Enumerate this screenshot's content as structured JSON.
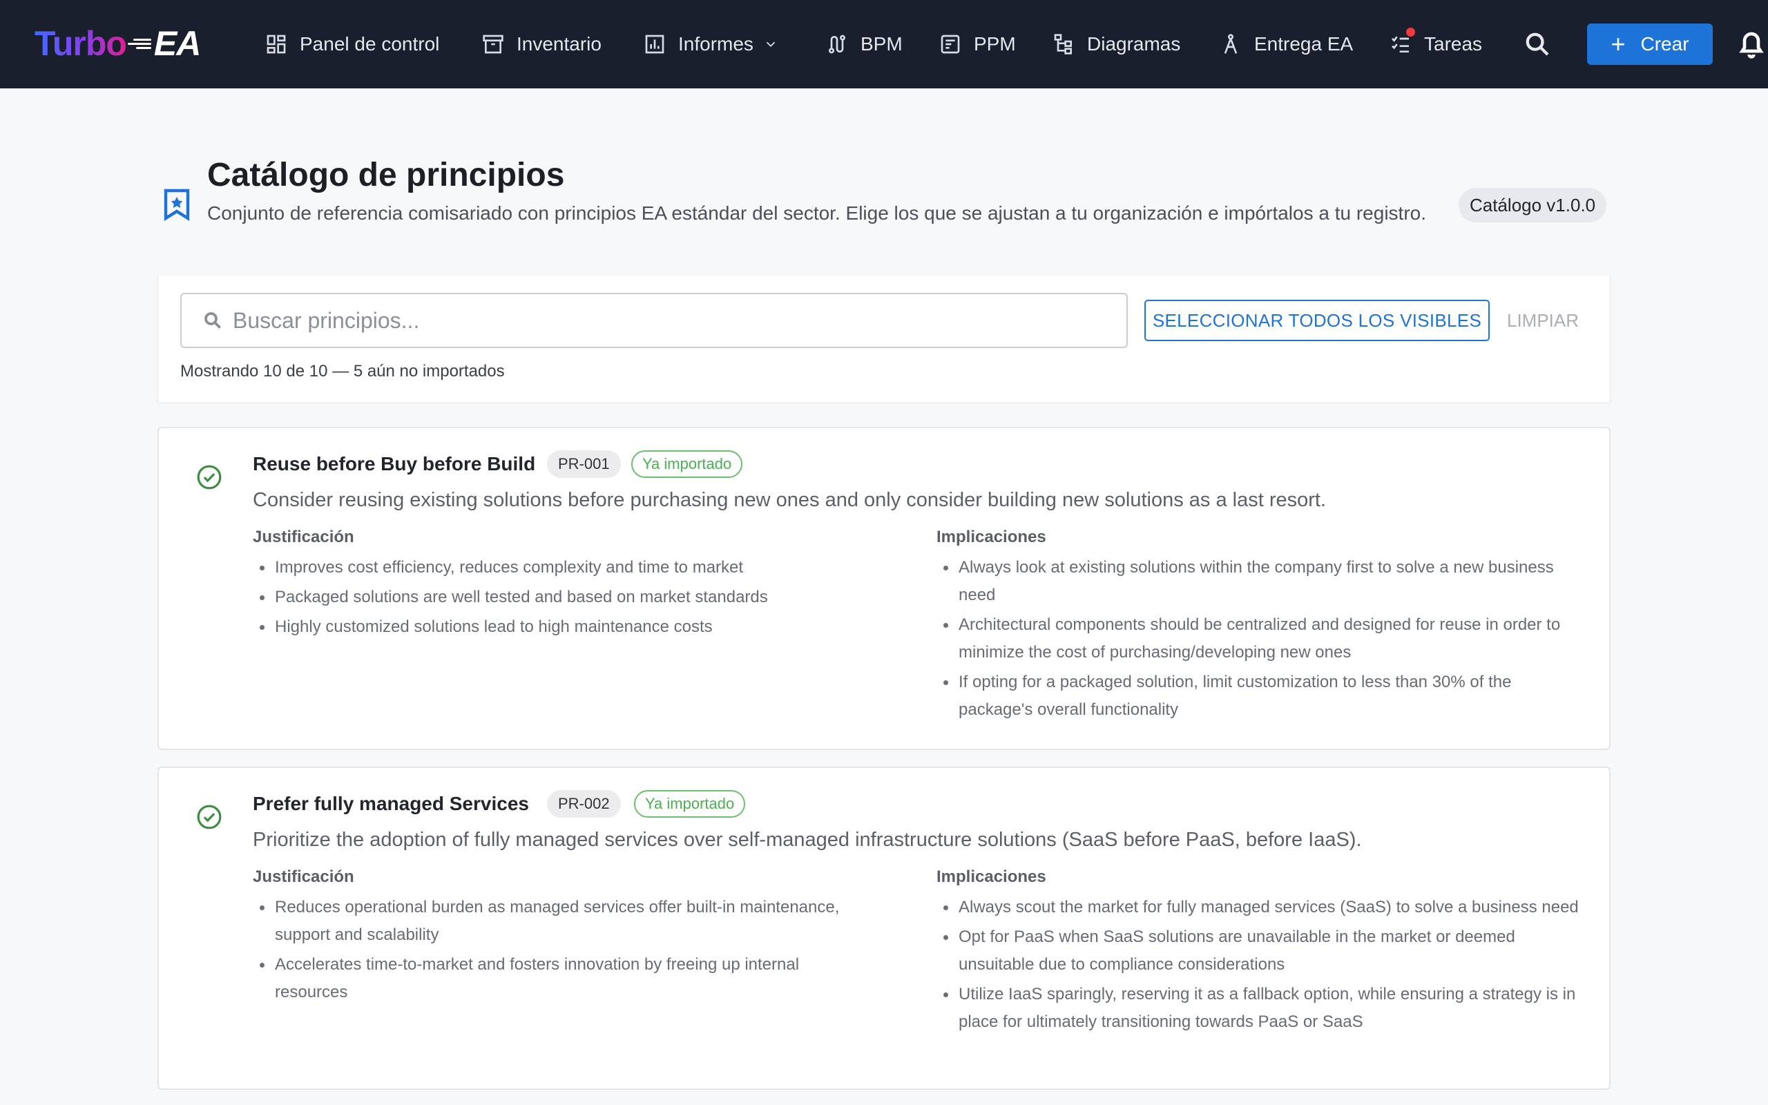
{
  "app": {
    "logo_text_1": "Turbo",
    "logo_text_2": "EA"
  },
  "nav": {
    "dashboard": "Panel de control",
    "inventory": "Inventario",
    "reports": "Informes",
    "bpm": "BPM",
    "ppm": "PPM",
    "diagrams": "Diagramas",
    "ea_delivery": "Entrega EA",
    "tasks": "Tareas",
    "create": "Crear"
  },
  "header": {
    "title": "Catálogo de principios",
    "subtitle": "Conjunto de referencia comisariado con principios EA estándar del sector. Elige los que se ajustan a tu organización e impórtalos a tu registro.",
    "version": "Catálogo v1.0.0"
  },
  "filter": {
    "search_placeholder": "Buscar principios...",
    "select_all": "SELECCIONAR TODOS LOS VISIBLES",
    "clear": "LIMPIAR",
    "count_text": "Mostrando 10 de 10 — 5 aún no importados"
  },
  "labels": {
    "justification": "Justificación",
    "implications": "Implicaciones"
  },
  "principles": [
    {
      "title": "Reuse before Buy before Build",
      "code": "PR-001",
      "status": "Ya importado",
      "description": "Consider reusing existing solutions before purchasing new ones and only consider building new solutions as a last resort.",
      "justification": [
        "Improves cost efficiency, reduces complexity and time to market",
        "Packaged solutions are well tested and based on market standards",
        "Highly customized solutions lead to high maintenance costs"
      ],
      "implications": [
        "Always look at existing solutions within the company first to solve a new business need",
        "Architectural components should be centralized and designed for reuse in order to minimize the cost of purchasing/developing new ones",
        "If opting for a packaged solution, limit customization to less than 30% of the package's overall functionality"
      ]
    },
    {
      "title": "Prefer fully managed Services",
      "code": "PR-002",
      "status": "Ya importado",
      "description": "Prioritize the adoption of fully managed services over self-managed infrastructure solutions (SaaS before PaaS, before IaaS).",
      "justification": [
        "Reduces operational burden as managed services offer built-in maintenance, support and scalability",
        "Accelerates time-to-market and fosters innovation by freeing up internal resources"
      ],
      "implications": [
        "Always scout the market for fully managed services (SaaS) to solve a business need",
        "Opt for PaaS when SaaS solutions are unavailable in the market or deemed unsuitable due to compliance considerations",
        "Utilize IaaS sparingly, reserving it as a fallback option, while ensuring a strategy is in place for ultimately transitioning towards PaaS or SaaS"
      ]
    }
  ],
  "colors": {
    "topbar": "#1a1f2e",
    "accent": "#1e73d8",
    "success": "#3c8d40"
  }
}
